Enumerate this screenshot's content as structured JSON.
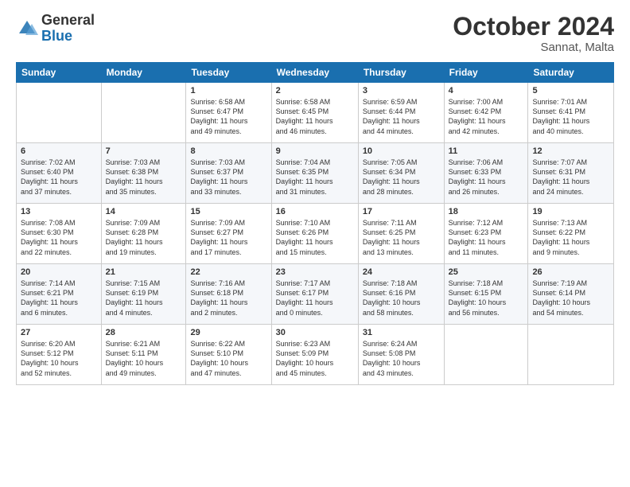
{
  "logo": {
    "general": "General",
    "blue": "Blue"
  },
  "header": {
    "month": "October 2024",
    "location": "Sannat, Malta"
  },
  "weekdays": [
    "Sunday",
    "Monday",
    "Tuesday",
    "Wednesday",
    "Thursday",
    "Friday",
    "Saturday"
  ],
  "weeks": [
    [
      {
        "day": "",
        "content": ""
      },
      {
        "day": "",
        "content": ""
      },
      {
        "day": "1",
        "content": "Sunrise: 6:58 AM\nSunset: 6:47 PM\nDaylight: 11 hours\nand 49 minutes."
      },
      {
        "day": "2",
        "content": "Sunrise: 6:58 AM\nSunset: 6:45 PM\nDaylight: 11 hours\nand 46 minutes."
      },
      {
        "day": "3",
        "content": "Sunrise: 6:59 AM\nSunset: 6:44 PM\nDaylight: 11 hours\nand 44 minutes."
      },
      {
        "day": "4",
        "content": "Sunrise: 7:00 AM\nSunset: 6:42 PM\nDaylight: 11 hours\nand 42 minutes."
      },
      {
        "day": "5",
        "content": "Sunrise: 7:01 AM\nSunset: 6:41 PM\nDaylight: 11 hours\nand 40 minutes."
      }
    ],
    [
      {
        "day": "6",
        "content": "Sunrise: 7:02 AM\nSunset: 6:40 PM\nDaylight: 11 hours\nand 37 minutes."
      },
      {
        "day": "7",
        "content": "Sunrise: 7:03 AM\nSunset: 6:38 PM\nDaylight: 11 hours\nand 35 minutes."
      },
      {
        "day": "8",
        "content": "Sunrise: 7:03 AM\nSunset: 6:37 PM\nDaylight: 11 hours\nand 33 minutes."
      },
      {
        "day": "9",
        "content": "Sunrise: 7:04 AM\nSunset: 6:35 PM\nDaylight: 11 hours\nand 31 minutes."
      },
      {
        "day": "10",
        "content": "Sunrise: 7:05 AM\nSunset: 6:34 PM\nDaylight: 11 hours\nand 28 minutes."
      },
      {
        "day": "11",
        "content": "Sunrise: 7:06 AM\nSunset: 6:33 PM\nDaylight: 11 hours\nand 26 minutes."
      },
      {
        "day": "12",
        "content": "Sunrise: 7:07 AM\nSunset: 6:31 PM\nDaylight: 11 hours\nand 24 minutes."
      }
    ],
    [
      {
        "day": "13",
        "content": "Sunrise: 7:08 AM\nSunset: 6:30 PM\nDaylight: 11 hours\nand 22 minutes."
      },
      {
        "day": "14",
        "content": "Sunrise: 7:09 AM\nSunset: 6:28 PM\nDaylight: 11 hours\nand 19 minutes."
      },
      {
        "day": "15",
        "content": "Sunrise: 7:09 AM\nSunset: 6:27 PM\nDaylight: 11 hours\nand 17 minutes."
      },
      {
        "day": "16",
        "content": "Sunrise: 7:10 AM\nSunset: 6:26 PM\nDaylight: 11 hours\nand 15 minutes."
      },
      {
        "day": "17",
        "content": "Sunrise: 7:11 AM\nSunset: 6:25 PM\nDaylight: 11 hours\nand 13 minutes."
      },
      {
        "day": "18",
        "content": "Sunrise: 7:12 AM\nSunset: 6:23 PM\nDaylight: 11 hours\nand 11 minutes."
      },
      {
        "day": "19",
        "content": "Sunrise: 7:13 AM\nSunset: 6:22 PM\nDaylight: 11 hours\nand 9 minutes."
      }
    ],
    [
      {
        "day": "20",
        "content": "Sunrise: 7:14 AM\nSunset: 6:21 PM\nDaylight: 11 hours\nand 6 minutes."
      },
      {
        "day": "21",
        "content": "Sunrise: 7:15 AM\nSunset: 6:19 PM\nDaylight: 11 hours\nand 4 minutes."
      },
      {
        "day": "22",
        "content": "Sunrise: 7:16 AM\nSunset: 6:18 PM\nDaylight: 11 hours\nand 2 minutes."
      },
      {
        "day": "23",
        "content": "Sunrise: 7:17 AM\nSunset: 6:17 PM\nDaylight: 11 hours\nand 0 minutes."
      },
      {
        "day": "24",
        "content": "Sunrise: 7:18 AM\nSunset: 6:16 PM\nDaylight: 10 hours\nand 58 minutes."
      },
      {
        "day": "25",
        "content": "Sunrise: 7:18 AM\nSunset: 6:15 PM\nDaylight: 10 hours\nand 56 minutes."
      },
      {
        "day": "26",
        "content": "Sunrise: 7:19 AM\nSunset: 6:14 PM\nDaylight: 10 hours\nand 54 minutes."
      }
    ],
    [
      {
        "day": "27",
        "content": "Sunrise: 6:20 AM\nSunset: 5:12 PM\nDaylight: 10 hours\nand 52 minutes."
      },
      {
        "day": "28",
        "content": "Sunrise: 6:21 AM\nSunset: 5:11 PM\nDaylight: 10 hours\nand 49 minutes."
      },
      {
        "day": "29",
        "content": "Sunrise: 6:22 AM\nSunset: 5:10 PM\nDaylight: 10 hours\nand 47 minutes."
      },
      {
        "day": "30",
        "content": "Sunrise: 6:23 AM\nSunset: 5:09 PM\nDaylight: 10 hours\nand 45 minutes."
      },
      {
        "day": "31",
        "content": "Sunrise: 6:24 AM\nSunset: 5:08 PM\nDaylight: 10 hours\nand 43 minutes."
      },
      {
        "day": "",
        "content": ""
      },
      {
        "day": "",
        "content": ""
      }
    ]
  ]
}
